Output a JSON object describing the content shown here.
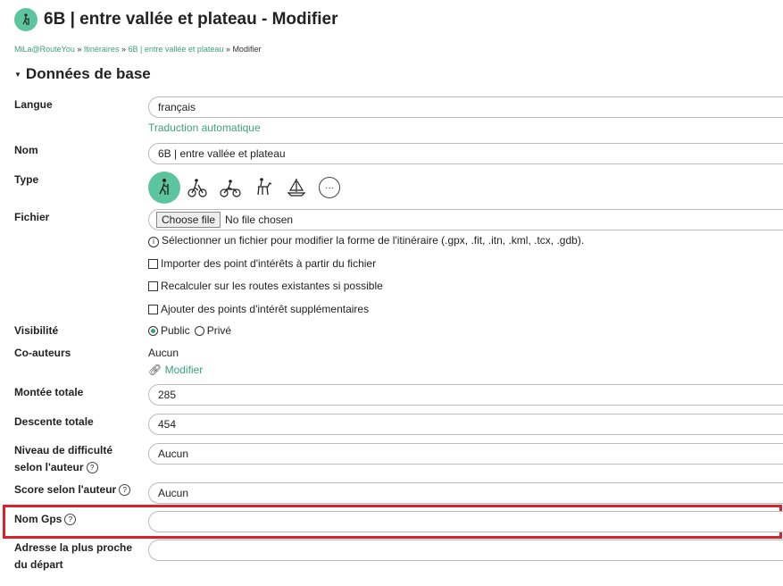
{
  "header": {
    "title": "6B | entre vallée et plateau - Modifier",
    "icon": "hiker-icon",
    "accent_color": "#5cc5a0"
  },
  "breadcrumb": {
    "items": [
      "MiLa@RouteYou",
      "Itinéraires",
      "6B | entre vallée et plateau"
    ],
    "separator": "»",
    "current": "Modifier"
  },
  "section": {
    "title": "Données de base"
  },
  "fields": {
    "langue": {
      "label": "Langue",
      "value": "français",
      "link": "Traduction automatique"
    },
    "nom": {
      "label": "Nom",
      "value": "6B | entre vallée et plateau"
    },
    "type": {
      "label": "Type",
      "options": [
        "walking-icon",
        "cycling-icon",
        "motorbike-icon",
        "horse-riding-icon",
        "sailing-icon",
        "more-icon"
      ],
      "selected": "walking-icon",
      "more_label": "···"
    },
    "fichier": {
      "label": "Fichier",
      "button": "Choose file",
      "status": "No file chosen",
      "info": "Sélectionner un fichier pour modifier la forme de l'itinéraire (.gpx, .fit, .itn, .kml, .tcx, .gdb).",
      "checkboxes": [
        "Importer des point d'intérêts à partir du fichier",
        "Recalculer sur les routes existantes si possible",
        "Ajouter des points d'intérêt supplémentaires"
      ]
    },
    "visibilite": {
      "label": "Visibilité",
      "options": [
        "Public",
        "Privé"
      ],
      "selected": "Public"
    },
    "coauteurs": {
      "label": "Co-auteurs",
      "value": "Aucun",
      "link": "Modifier"
    },
    "montee": {
      "label": "Montée totale",
      "value": "285"
    },
    "descente": {
      "label": "Descente totale",
      "value": "454"
    },
    "difficulte": {
      "label_line1": "Niveau de difficulté",
      "label_line2": "selon l'auteur",
      "value": "Aucun"
    },
    "score": {
      "label": "Score selon l'auteur",
      "value": "Aucun"
    },
    "nomgps": {
      "label": "Nom Gps",
      "value": ""
    },
    "adresse": {
      "label_line1": "Adresse la plus proche",
      "label_line2": "du départ",
      "value": ""
    }
  }
}
